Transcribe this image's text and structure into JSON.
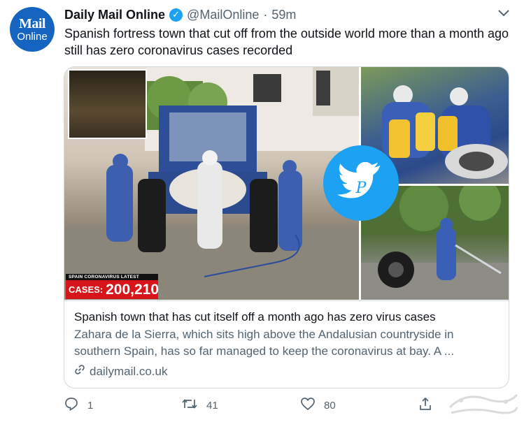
{
  "author": {
    "avatar_line1": "Mail",
    "avatar_line2": "Online",
    "name": "Daily Mail Online",
    "verified_icon": "✓",
    "handle": "@MailOnline",
    "separator": "·",
    "time": "59m"
  },
  "tweet_text": "Spanish fortress town that cut off from the outside world more than a month ago still has zero coronavirus cases recorded",
  "card": {
    "overlay_small": "SPAIN CORONAVIRUS LATEST",
    "overlay_label": "CASES:",
    "overlay_value": "200,210",
    "title": "Spanish town that has cut itself off a month ago has zero virus cases",
    "description": "Zahara de la Sierra, which sits high above the Andalusian countryside in southern Spain, has so far managed to keep the coronavirus at bay. A ...",
    "domain": "dailymail.co.uk",
    "domain_icon": "link-icon"
  },
  "actions": {
    "reply_count": "1",
    "retweet_count": "41",
    "like_count": "80"
  },
  "colors": {
    "accent": "#1da1f2",
    "secondary_text": "#536471",
    "border": "#cfd9de",
    "avatar_bg": "#1565c0",
    "cases_red": "#d7141a"
  }
}
